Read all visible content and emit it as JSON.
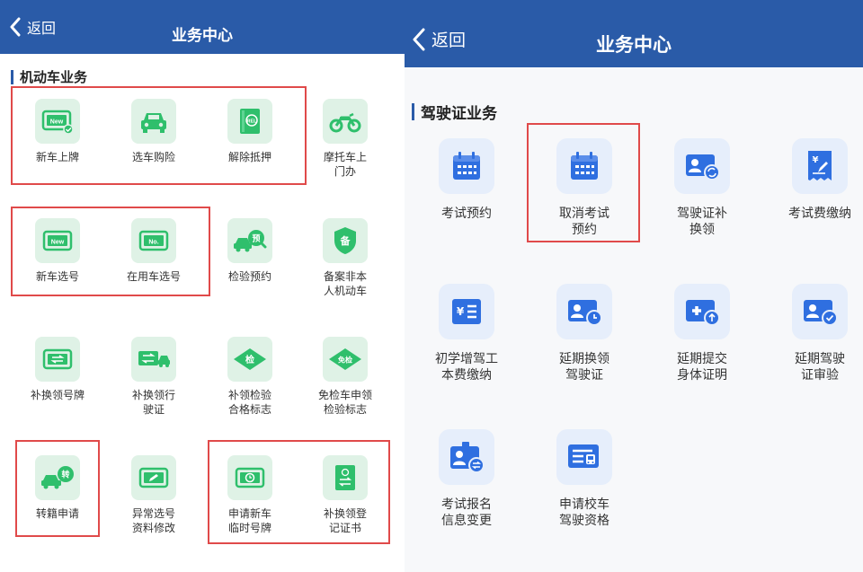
{
  "left": {
    "back_label": "返回",
    "title": "业务中心",
    "section_title": "机动车业务",
    "items": [
      {
        "label": [
          "新车上牌"
        ],
        "icon": "new-plate-icon"
      },
      {
        "label": [
          "选车购险"
        ],
        "icon": "car-icon"
      },
      {
        "label": [
          "解除抵押"
        ],
        "icon": "document-icon"
      },
      {
        "label": [
          "摩托车上",
          "门办"
        ],
        "icon": "motorcycle-icon"
      },
      {
        "label": [
          "新车选号"
        ],
        "icon": "new-plate-icon"
      },
      {
        "label": [
          "在用车选号"
        ],
        "icon": "plate-no-icon"
      },
      {
        "label": [
          "检验预约"
        ],
        "icon": "inspection-appointment-icon"
      },
      {
        "label": [
          "备案非本",
          "人机动车"
        ],
        "icon": "shield-icon"
      },
      {
        "label": [
          "补换领号牌"
        ],
        "icon": "plate-exchange-icon"
      },
      {
        "label": [
          "补换领行",
          "驶证"
        ],
        "icon": "license-exchange-icon"
      },
      {
        "label": [
          "补领检验",
          "合格标志"
        ],
        "icon": "inspection-badge-icon"
      },
      {
        "label": [
          "免检车申领",
          "检验标志"
        ],
        "icon": "exempt-badge-icon"
      },
      {
        "label": [
          "转籍申请"
        ],
        "icon": "transfer-icon"
      },
      {
        "label": [
          "异常选号",
          "资料修改"
        ],
        "icon": "edit-plate-icon"
      },
      {
        "label": [
          "申请新车",
          "临时号牌"
        ],
        "icon": "temp-plate-icon"
      },
      {
        "label": [
          "补换领登",
          "记证书"
        ],
        "icon": "registration-book-icon"
      }
    ],
    "badges": {
      "new": "New",
      "no": "No.",
      "appoint": "预",
      "file": "备",
      "inspect": "检",
      "exempt": "免检",
      "transfer": "转",
      "release": "REL"
    }
  },
  "right": {
    "back_label": "返回",
    "title": "业务中心",
    "section_title": "驾驶证业务",
    "items": [
      {
        "label": [
          "考试预约"
        ],
        "icon": "calendar-icon"
      },
      {
        "label": [
          "取消考试",
          "预约"
        ],
        "icon": "calendar-icon"
      },
      {
        "label": [
          "驾驶证补",
          "换领"
        ],
        "icon": "id-card-exchange-icon"
      },
      {
        "label": [
          "考试费缴纳"
        ],
        "icon": "receipt-icon"
      },
      {
        "label": [
          "初学增驾工",
          "本费缴纳"
        ],
        "icon": "fee-list-icon"
      },
      {
        "label": [
          "延期换领",
          "驾驶证"
        ],
        "icon": "id-card-clock-icon"
      },
      {
        "label": [
          "延期提交",
          "身体证明"
        ],
        "icon": "medical-upload-icon"
      },
      {
        "label": [
          "延期驾驶",
          "证审验"
        ],
        "icon": "id-card-check-icon"
      },
      {
        "label": [
          "考试报名",
          "信息变更"
        ],
        "icon": "badge-exchange-icon"
      },
      {
        "label": [
          "申请校车",
          "驾驶资格"
        ],
        "icon": "bus-icon"
      }
    ]
  },
  "colors": {
    "header": "#2a5ba8",
    "green": "#2fbf6c",
    "blue": "#2f6fe0",
    "highlight": "#e04a4a"
  }
}
